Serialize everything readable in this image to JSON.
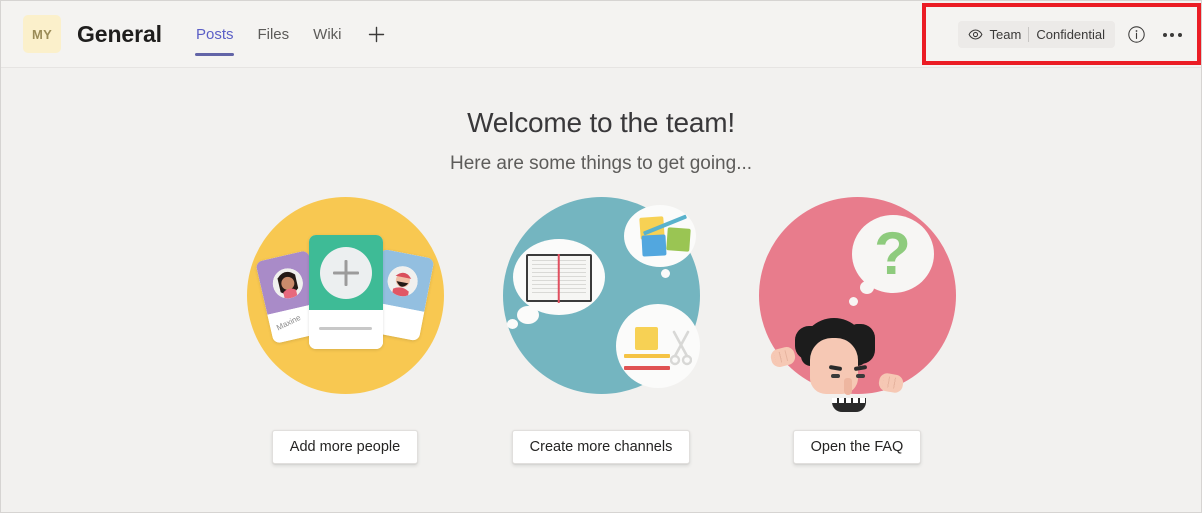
{
  "header": {
    "team_avatar_initials": "MY",
    "channel_title": "General",
    "tabs": [
      {
        "label": "Posts",
        "active": true
      },
      {
        "label": "Files",
        "active": false
      },
      {
        "label": "Wiki",
        "active": false
      }
    ],
    "add_tab_glyph": "+",
    "sensitivity_badge": {
      "eye_icon": "eye-icon",
      "scope_label": "Team",
      "classification_label": "Confidential"
    },
    "info_icon": "info-circle-icon",
    "more_options_icon": "ellipsis-icon"
  },
  "annotation": {
    "highlight_color": "#eb1c24"
  },
  "main": {
    "welcome_title": "Welcome to the team!",
    "welcome_subtitle": "Here are some things to get going...",
    "cards": [
      {
        "illustration": "people-cards-illustration",
        "circle_color": "#f8c851",
        "sample_name": "Maxine",
        "button_label": "Add more people"
      },
      {
        "illustration": "channels-notebook-illustration",
        "circle_color": "#74b5c0",
        "button_label": "Create more channels"
      },
      {
        "illustration": "faq-question-illustration",
        "circle_color": "#e87c8c",
        "question_glyph": "?",
        "button_label": "Open the FAQ"
      }
    ]
  }
}
